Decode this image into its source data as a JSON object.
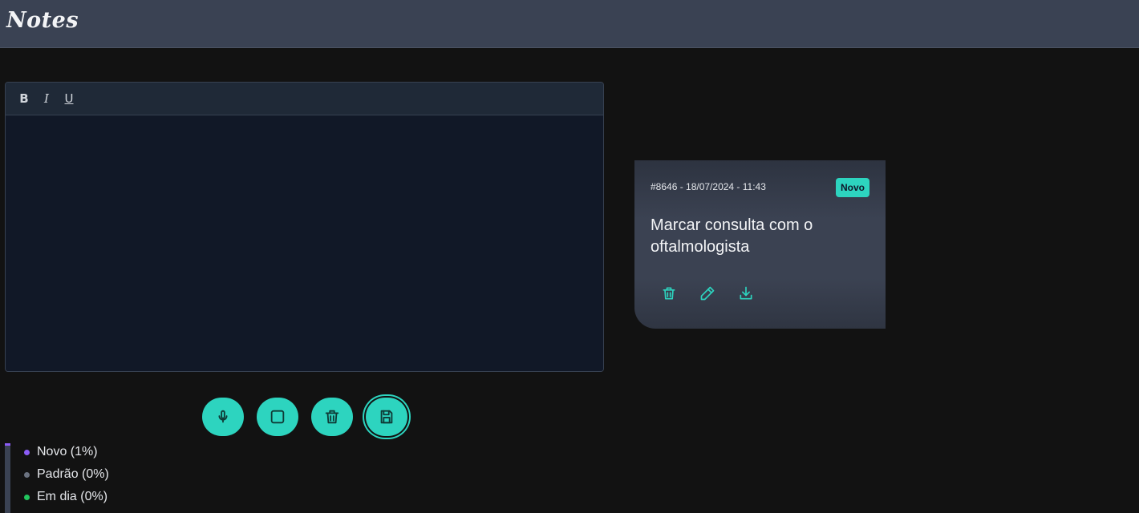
{
  "header": {
    "title": "Notes"
  },
  "editor": {
    "toolbar": {
      "bold": "B",
      "italic": "I",
      "underline": "U"
    },
    "content": ""
  },
  "actions": [
    {
      "name": "microphone",
      "icon": "microphone-icon"
    },
    {
      "name": "stop",
      "icon": "square-icon"
    },
    {
      "name": "delete",
      "icon": "trash-icon"
    },
    {
      "name": "save",
      "icon": "save-icon"
    }
  ],
  "note": {
    "meta": "#8646 - 18/07/2024 - 11:43",
    "badge": "Novo",
    "text": "Marcar consulta com o oftalmologista",
    "actions": [
      "trash-icon",
      "pencil-icon",
      "download-icon"
    ]
  },
  "legend": [
    {
      "label": "Novo (1%)",
      "color": "#8b5cf6"
    },
    {
      "label": "Padrão (0%)",
      "color": "#6b7280"
    },
    {
      "label": "Em dia (0%)",
      "color": "#22c55e"
    }
  ],
  "colors": {
    "accent": "#2dd4bf",
    "topbar": "#3a4253",
    "background": "#121212"
  }
}
